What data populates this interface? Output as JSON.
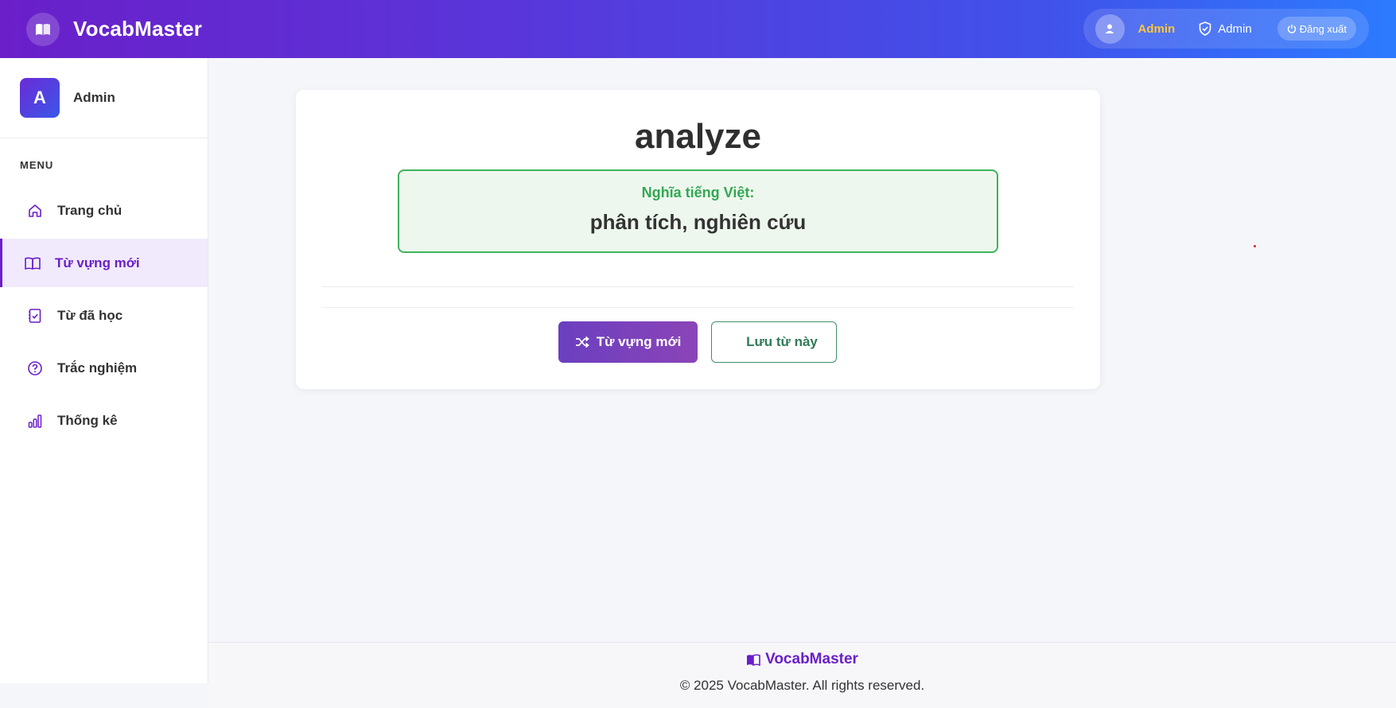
{
  "header": {
    "app_name": "VocabMaster",
    "user_name": "Admin",
    "role": "Admin",
    "logout_label": "Đăng xuất"
  },
  "sidebar": {
    "profile_initial": "A",
    "profile_name": "Admin",
    "menu_title": "MENU",
    "items": [
      {
        "label": "Trang chủ",
        "icon": "home-icon",
        "active": false
      },
      {
        "label": "Từ vựng mới",
        "icon": "book-icon",
        "active": true
      },
      {
        "label": "Từ đã học",
        "icon": "checklist-icon",
        "active": false
      },
      {
        "label": "Trắc nghiệm",
        "icon": "question-icon",
        "active": false
      },
      {
        "label": "Thống kê",
        "icon": "bar-chart-icon",
        "active": false
      }
    ]
  },
  "card": {
    "word": "analyze",
    "meaning_label": "Nghĩa tiếng Việt:",
    "meaning": "phân tích, nghiên cứu",
    "new_word_button": "Từ vựng mới",
    "save_button": "Lưu từ này"
  },
  "footer": {
    "brand": "VocabMaster",
    "copyright": "© 2025 VocabMaster. All rights reserved."
  },
  "colors": {
    "accent": "#6a1fc9",
    "header_gradient_end": "#2c7bff",
    "success": "#3fb35a",
    "user_name": "#ffc83a"
  }
}
